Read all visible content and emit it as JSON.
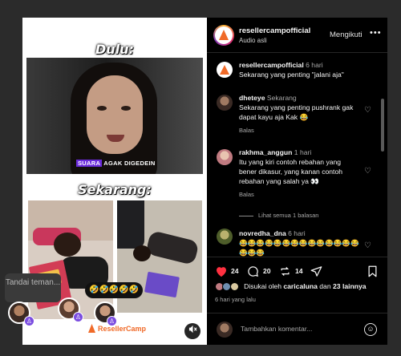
{
  "media": {
    "caption_top": "Dulu:",
    "caption_mid": "Sekarang:",
    "subtitle_highlight": "SUARA",
    "subtitle_rest": "AGAK DIGEDEIN",
    "emoji_bar": "🤣🤣🤣🤣🤣",
    "brand": "ResellerCamp",
    "mute_icon": "muted-speaker-icon"
  },
  "tag_tooltip": "Tandai teman...",
  "header": {
    "username": "resellercampofficial",
    "subtitle": "Audio asli",
    "follow_label": "Mengikuti",
    "more_label": "•••"
  },
  "comments": [
    {
      "user": "resellercampofficial",
      "time": "6 hari",
      "text": "Sekarang yang penting \"jalani aja\"",
      "reply": ""
    },
    {
      "user": "dheteye",
      "time": "Sekarang",
      "text": "Sekarang yang penting pushrank gak dapat kayu aja Kak 😂",
      "reply": "Balas"
    },
    {
      "user": "rakhma_anggun",
      "time": "1 hari",
      "text": "Itu yang kiri contoh rebahan yang bener dikasur, yang kanan contoh rebahan yang salah ya 👀",
      "reply": "Balas"
    },
    {
      "user": "novredha_dna",
      "time": "6 hari",
      "text": "😂😂😂😂😂😂😂😂😂😂😂😂😂😂😂😂😂",
      "reply": ""
    }
  ],
  "view_replies": "Lihat semua 1 balasan",
  "actions": {
    "likes": "24",
    "comments": "20",
    "reposts": "14",
    "liked_by_prefix": "Disukai oleh",
    "liked_by_user": "caricaluna",
    "liked_by_and": "dan",
    "liked_by_others": "23 lainnya",
    "posted_ago": "6 hari yang lalu"
  },
  "composer": {
    "placeholder": "Tambahkan komentar..."
  },
  "colors": {
    "panel_bg": "#000000",
    "like_red": "#ff3040",
    "brand_orange": "#f06a28",
    "badge_purple": "#7b4de0"
  }
}
